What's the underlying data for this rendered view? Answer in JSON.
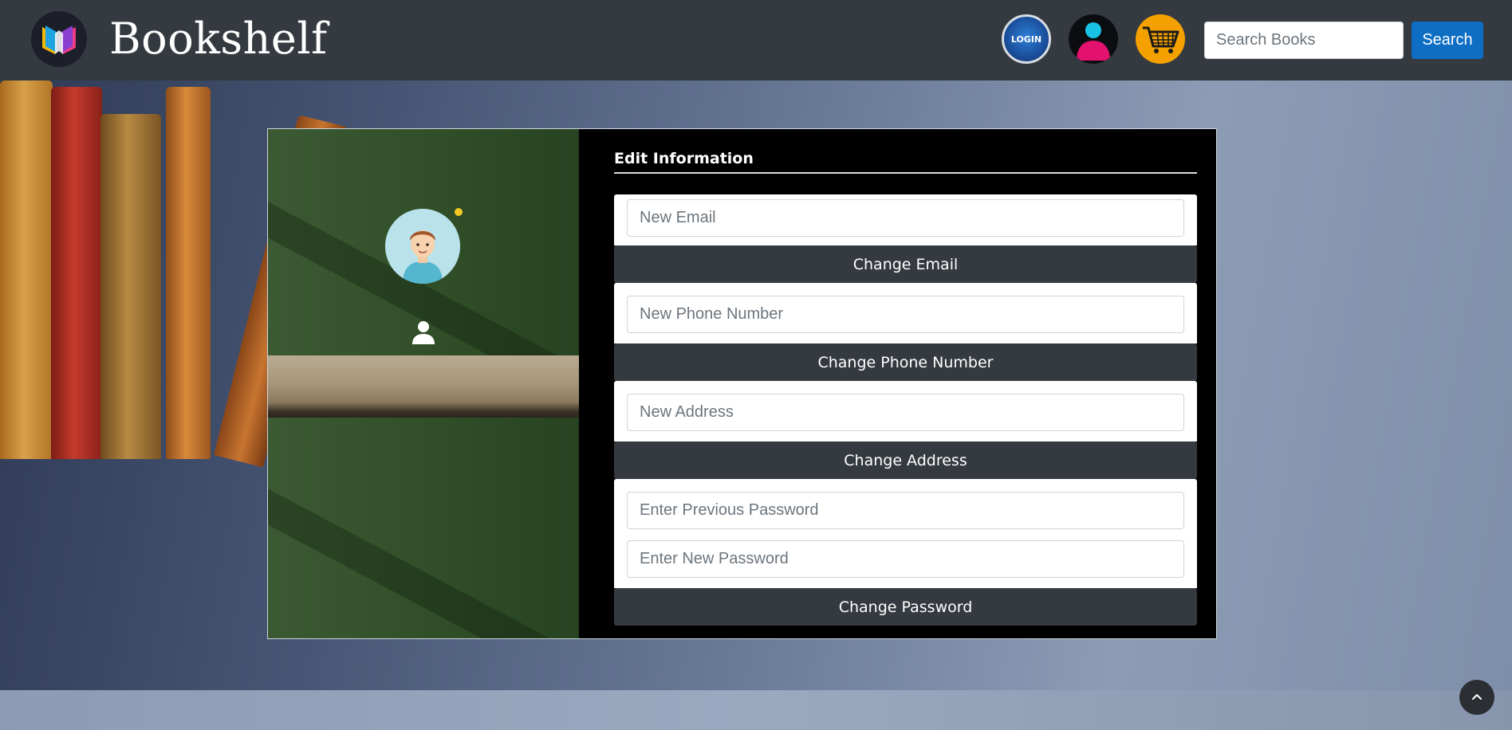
{
  "brand": {
    "name": "Bookshelf"
  },
  "header": {
    "login_label": "LOGIN",
    "search_placeholder": "Search Books",
    "search_button": "Search"
  },
  "form": {
    "title": "Edit Information",
    "email_placeholder": "New Email",
    "email_button": "Change Email",
    "phone_placeholder": "New Phone Number",
    "phone_button": "Change Phone Number",
    "address_placeholder": "New Address",
    "address_button": "Change Address",
    "prev_password_placeholder": "Enter Previous Password",
    "new_password_placeholder": "Enter New Password",
    "password_button": "Change Password"
  },
  "icons": {
    "logo": "book-logo-icon",
    "user": "user-account-icon",
    "cart": "shopping-cart-icon",
    "person": "person-icon",
    "scroll_top": "chevron-up-icon"
  },
  "colors": {
    "navbar": "#343a40",
    "primary": "#0d6ec4",
    "dark_button": "#343a40",
    "cart_orange": "#f4a100"
  }
}
